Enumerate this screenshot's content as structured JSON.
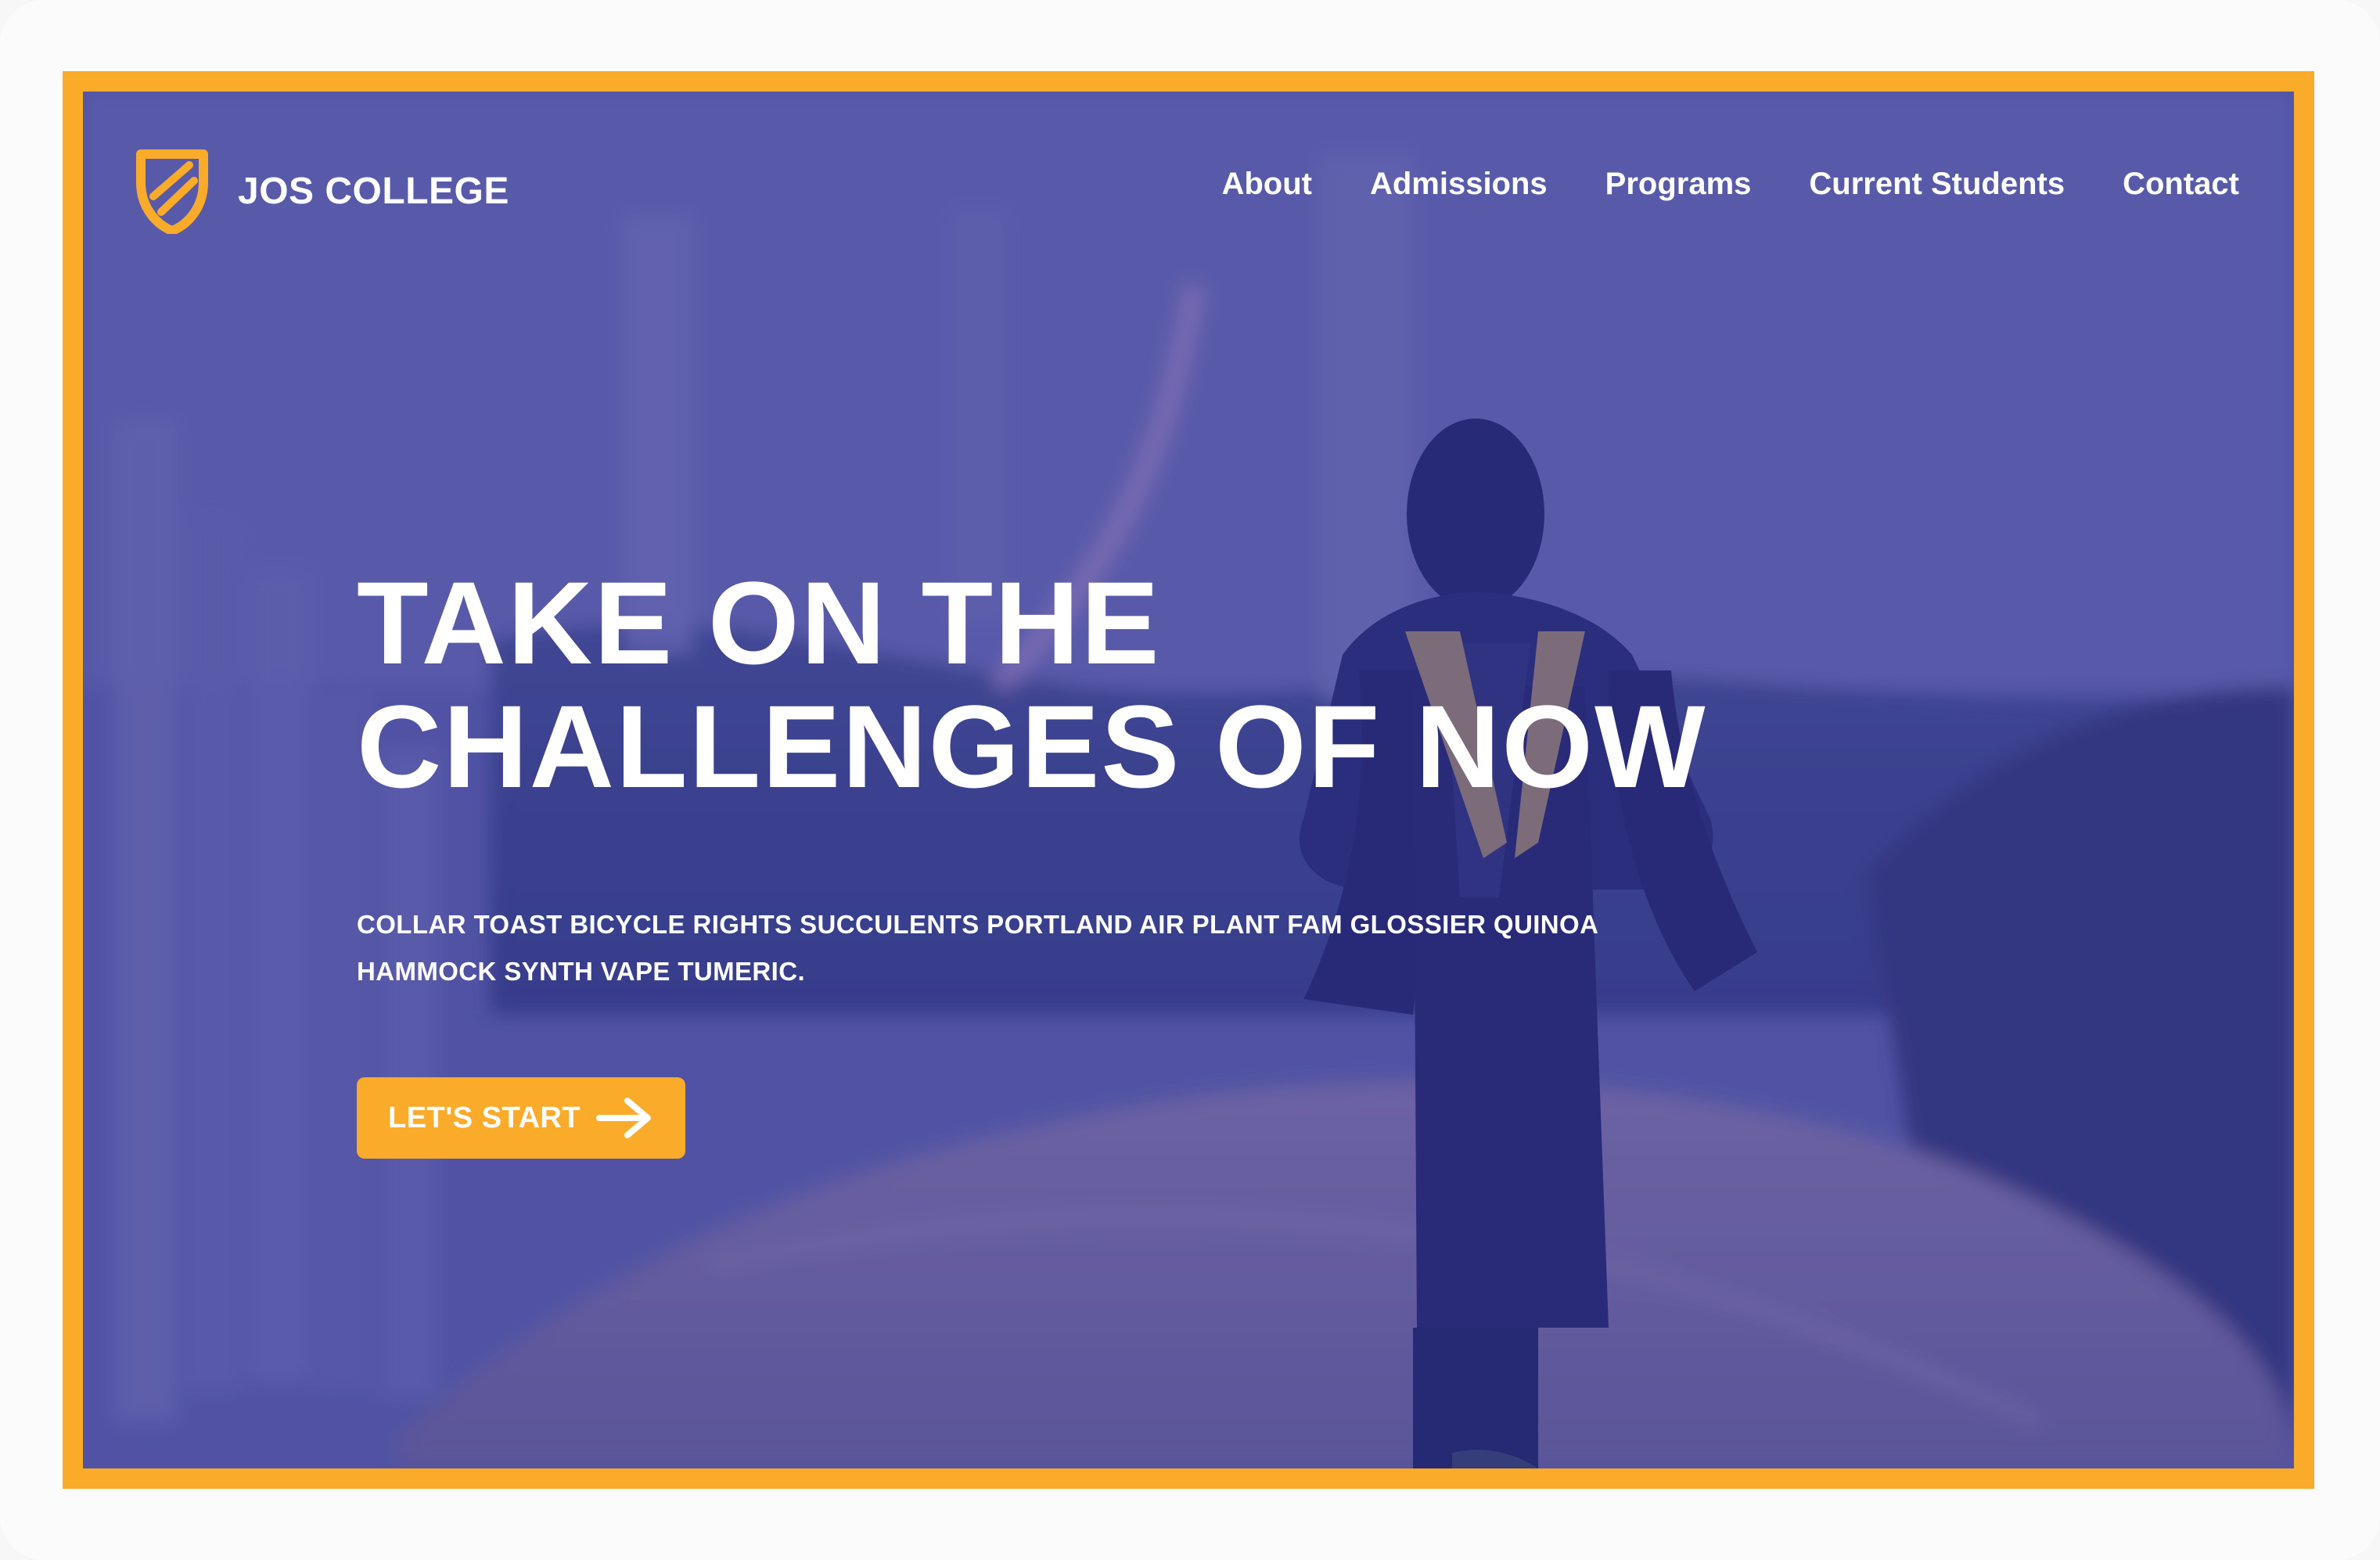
{
  "brand": {
    "name": "JOS COLLEGE",
    "logo_icon": "shield-logo-icon"
  },
  "nav": {
    "items": [
      {
        "label": "About"
      },
      {
        "label": "Admissions"
      },
      {
        "label": "Programs"
      },
      {
        "label": "Current Students"
      },
      {
        "label": "Contact"
      }
    ]
  },
  "hero": {
    "headline_line1": "TAKE ON THE",
    "headline_line2": "CHALLENGES OF NOW",
    "subheadline": "COLLAR TOAST BICYCLE RIGHTS SUCCULENTS PORTLAND AIR PLANT FAM GLOSSIER QUINOA HAMMOCK SYNTH VAPE TUMERIC.",
    "cta_label": "LET'S START",
    "cta_icon": "arrow-right-icon"
  },
  "colors": {
    "accent": "#fbab2a",
    "overlay": "#5b5da7",
    "text": "#ffffff"
  }
}
